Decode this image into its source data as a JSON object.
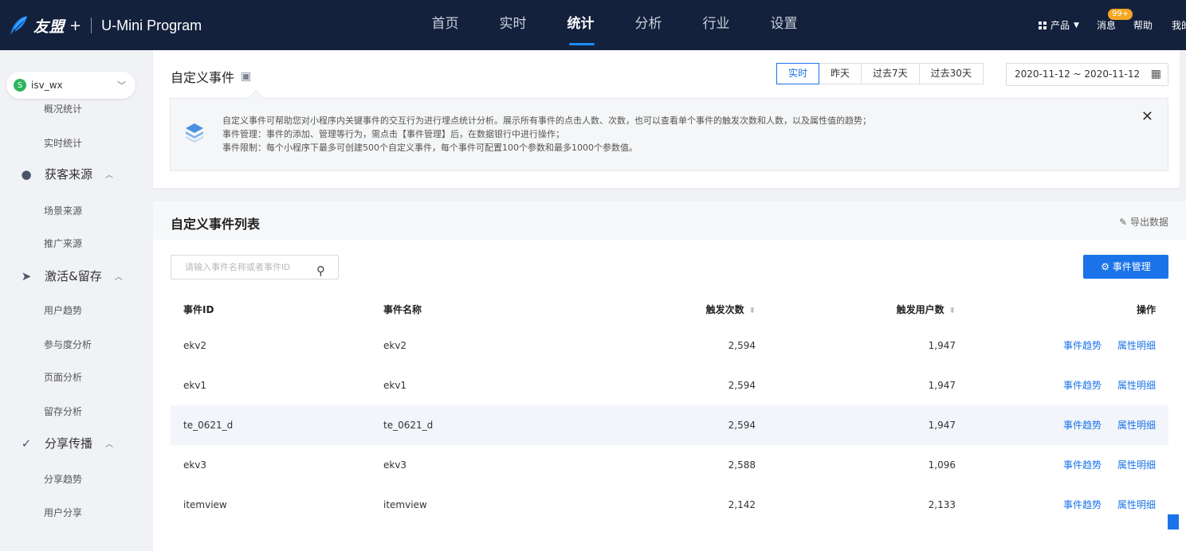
{
  "header": {
    "logo": "友盟",
    "logo_plus": "+",
    "product": "U-Mini Program",
    "nav": [
      "首页",
      "实时",
      "统计",
      "分析",
      "行业",
      "设置"
    ],
    "active_nav": "统计",
    "right": {
      "products": "产品",
      "messages": "消息",
      "badge": "99+",
      "help": "帮助",
      "mine": "我的"
    }
  },
  "sidebar": {
    "app_name": "isv_wx",
    "items": [
      {
        "type": "sub",
        "label": "概况统计"
      },
      {
        "type": "sub",
        "label": "实时统计"
      },
      {
        "type": "group",
        "label": "获客来源",
        "icon": "users-icon"
      },
      {
        "type": "sub",
        "label": "场景来源"
      },
      {
        "type": "sub",
        "label": "推广来源"
      },
      {
        "type": "group",
        "label": "激活&留存",
        "icon": "cursor-icon"
      },
      {
        "type": "sub",
        "label": "用户趋势"
      },
      {
        "type": "sub",
        "label": "参与度分析"
      },
      {
        "type": "sub",
        "label": "页面分析"
      },
      {
        "type": "sub",
        "label": "留存分析"
      },
      {
        "type": "group",
        "label": "分享传播",
        "icon": "send-icon"
      },
      {
        "type": "sub",
        "label": "分享趋势"
      },
      {
        "type": "sub",
        "label": "用户分享"
      }
    ]
  },
  "page": {
    "title": "自定义事件",
    "range_tabs": [
      "实时",
      "昨天",
      "过去7天",
      "过去30天"
    ],
    "active_range": "实时",
    "date_range": "2020-11-12 ~ 2020-11-12",
    "notice": [
      "自定义事件可帮助您对小程序内关键事件的交互行为进行埋点统计分析。展示所有事件的点击人数、次数，也可以查看单个事件的触发次数和人数，以及属性值的趋势；",
      "事件管理：事件的添加、管理等行为，需点击【事件管理】后，在数据银行中进行操作；",
      "事件限制：每个小程序下最多可创建500个自定义事件，每个事件可配置100个参数和最多1000个参数值。"
    ]
  },
  "list": {
    "title": "自定义事件列表",
    "export_label": "导出数据",
    "search_placeholder": "请输入事件名称或者事件ID",
    "manage_label": "事件管理",
    "columns": {
      "id": "事件ID",
      "name": "事件名称",
      "count": "触发次数",
      "users": "触发用户数",
      "ops": "操作"
    },
    "op_trend": "事件趋势",
    "op_detail": "属性明细",
    "rows": [
      {
        "id": "ekv2",
        "name": "ekv2",
        "count": "2,594",
        "users": "1,947"
      },
      {
        "id": "ekv1",
        "name": "ekv1",
        "count": "2,594",
        "users": "1,947"
      },
      {
        "id": "te_0621_d",
        "name": "te_0621_d",
        "count": "2,594",
        "users": "1,947"
      },
      {
        "id": "ekv3",
        "name": "ekv3",
        "count": "2,588",
        "users": "1,096"
      },
      {
        "id": "itemview",
        "name": "itemview",
        "count": "2,142",
        "users": "2,133"
      }
    ]
  },
  "colors": {
    "header_bg": "#14213d",
    "accent": "#1a73e8",
    "highlight_row": "#f2f5fa"
  }
}
